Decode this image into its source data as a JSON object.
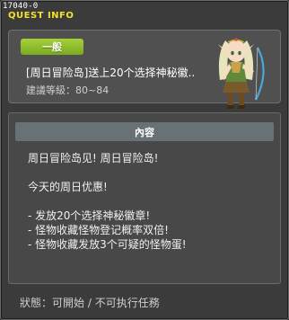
{
  "window": {
    "quest_id": "17040-0",
    "title": "QUEST INFO"
  },
  "header": {
    "badge": "一般",
    "quest_name": "[周日冒险岛]送上20个选择神秘徽..",
    "level_label": "建議等級：",
    "level_range": "80~84"
  },
  "npc": {
    "icon": "elf-archer-npc-portrait"
  },
  "content": {
    "header": "內容",
    "lines": [
      "周日冒险岛见! 周日冒险岛!",
      "",
      "今天的周日优惠!",
      "",
      "- 发放20个选择神秘徽章!",
      "- 怪物收藏怪物登记概率双倍!",
      "- 怪物收藏发放3个可疑的怪物蛋!"
    ]
  },
  "status": {
    "label": "狀態：",
    "text": "可開始 / 不可执行任務"
  },
  "colors": {
    "title": "#f4e22a",
    "badge": "#8fbf2c",
    "panel": "#505050",
    "content_header": "#687276"
  }
}
